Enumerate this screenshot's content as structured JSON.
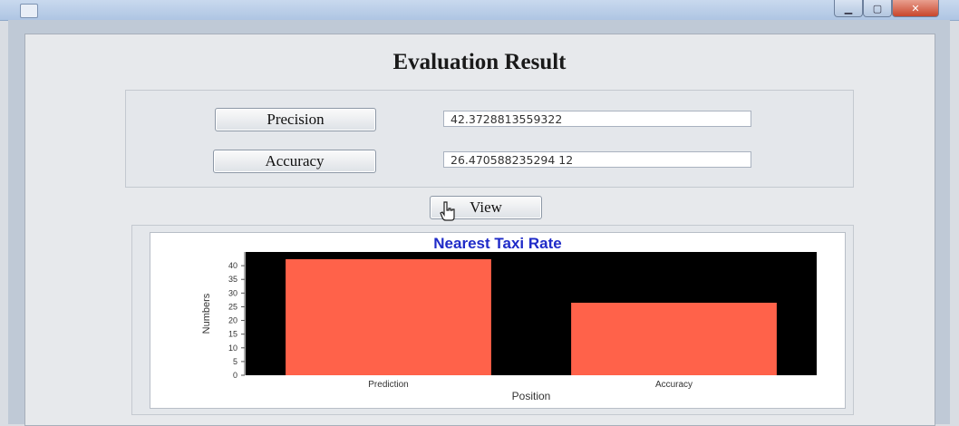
{
  "window": {
    "title": ""
  },
  "heading": "Evaluation Result",
  "metrics": {
    "precision_label": "Precision",
    "precision_value": "42.3728813559322",
    "accuracy_label": "Accuracy",
    "accuracy_value": "26.470588235294 12"
  },
  "view_button": "View",
  "chart_data": {
    "type": "bar",
    "title": "Nearest Taxi Rate",
    "xlabel": "Position",
    "ylabel": "Numbers",
    "categories": [
      "Prediction",
      "Accuracy"
    ],
    "values": [
      42.37,
      26.47
    ],
    "ylim": [
      0,
      45
    ],
    "yticks": [
      0,
      5,
      10,
      15,
      20,
      25,
      30,
      35,
      40
    ],
    "colors": {
      "bar": "#ff624a",
      "plot_bg": "#000000",
      "title": "#1f2bc8"
    }
  }
}
